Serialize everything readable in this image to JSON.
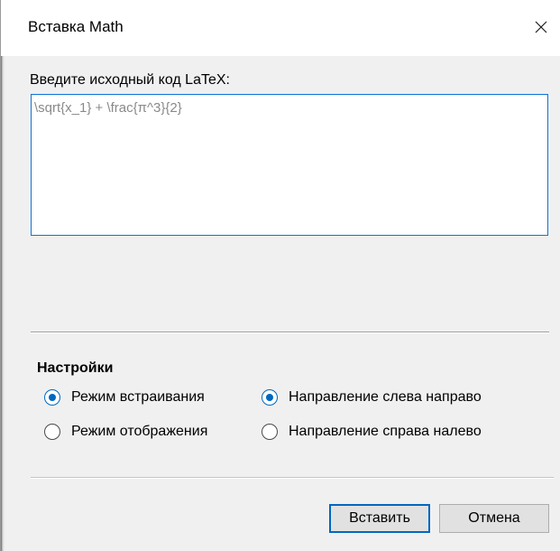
{
  "dialog": {
    "title": "Вставка Math",
    "close_icon": "close-icon"
  },
  "source": {
    "label": "Введите исходный код LaTeX:",
    "value": "\\sqrt{x_1} + \\frac{π^3}{2}"
  },
  "settings": {
    "heading": "Настройки",
    "options": [
      {
        "label": "Режим встраивания",
        "checked": true
      },
      {
        "label": "Режим отображения",
        "checked": false
      },
      {
        "label": "Направление слева направо",
        "checked": true
      },
      {
        "label": "Направление справа налево",
        "checked": false
      }
    ]
  },
  "buttons": {
    "insert_label": "Вставить",
    "cancel_label": "Отмена"
  },
  "colors": {
    "accent": "#0067c0",
    "focus_border": "#0c74d8",
    "dialog_background": "#f0f0f0",
    "titlebar_background": "#ffffff",
    "placeholder_text": "#8a8a8a"
  }
}
